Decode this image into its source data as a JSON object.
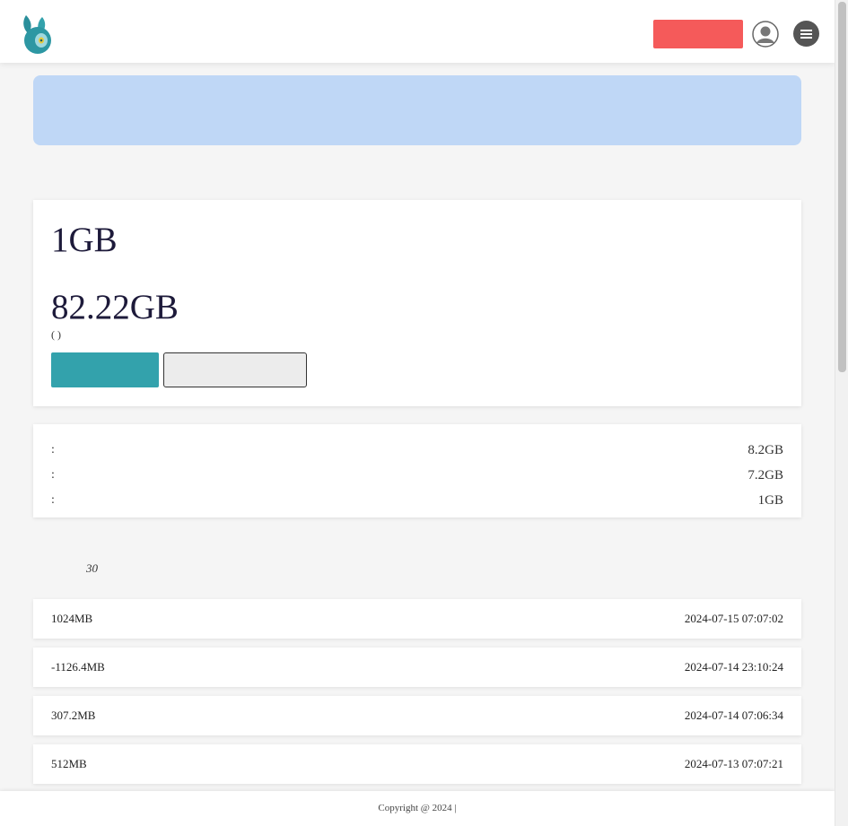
{
  "header": {
    "brand": "",
    "action_button": "",
    "avatar_icon": "user-avatar-icon",
    "menu_icon": "hamburger-menu-icon"
  },
  "notice": {
    "title": "",
    "text": ""
  },
  "section_title": "",
  "main_card": {
    "value_1": "1GB",
    "label_1": "",
    "value_2": "82.22GB",
    "label_2": "(   )",
    "primary_button": "",
    "secondary_button": ""
  },
  "stats": [
    {
      "label": ":",
      "value": "8.2GB"
    },
    {
      "label": ":",
      "value": "7.2GB"
    },
    {
      "label": ":",
      "value": "1GB"
    }
  ],
  "history": {
    "title": "",
    "subtitle_prefix": "",
    "subtitle_num": "30",
    "subtitle_suffix": ""
  },
  "records": [
    {
      "amount": "1024MB",
      "type": "",
      "type_color": "#2b8fd6",
      "time": "2024-07-15 07:07:02"
    },
    {
      "amount": "-1126.4MB",
      "type": "",
      "type_color": "#e53935",
      "time": "2024-07-14 23:10:24"
    },
    {
      "amount": "307.2MB",
      "type": "",
      "type_color": "#2b8fd6",
      "time": "2024-07-14 07:06:34"
    },
    {
      "amount": "512MB",
      "type": "",
      "type_color": "#2b8fd6",
      "time": "2024-07-13 07:07:21"
    }
  ],
  "footer": {
    "text": "Copyright @ 2024  | "
  },
  "colors": {
    "accent_red": "#f55a5a",
    "accent_teal": "#33a2ac",
    "notice_bg": "#bfd7f6"
  }
}
